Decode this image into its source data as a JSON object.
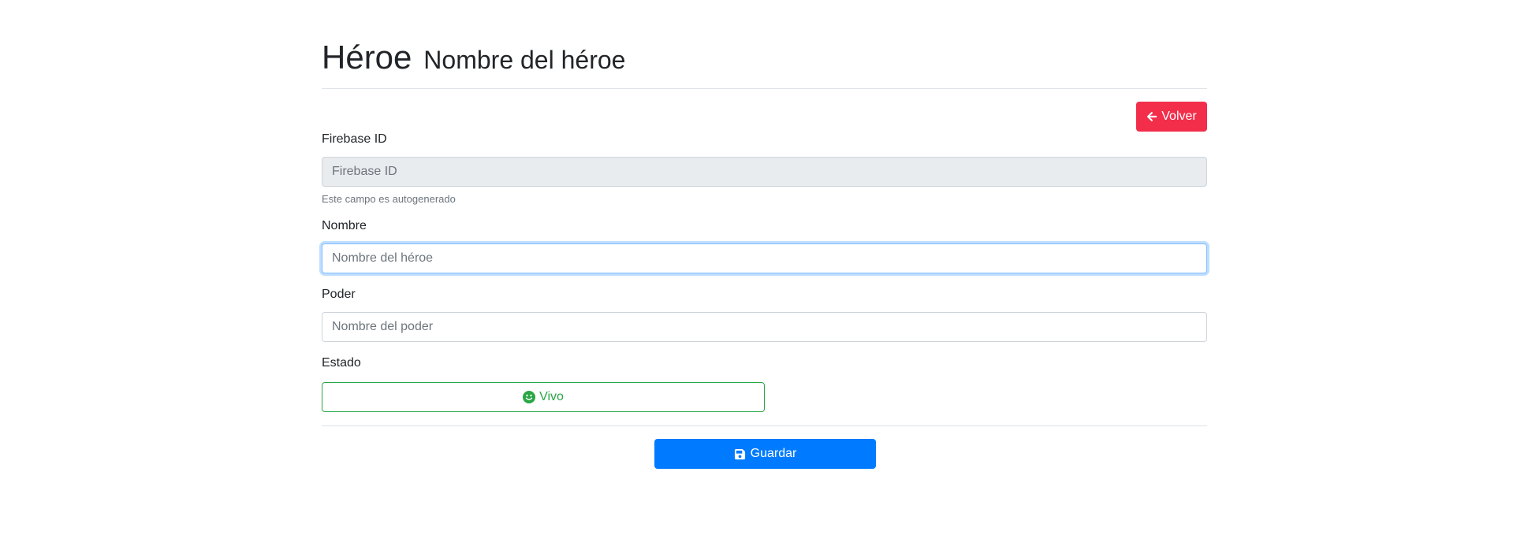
{
  "header": {
    "title": "Héroe",
    "subtitle": "Nombre del héroe"
  },
  "actions": {
    "back_label": "Volver",
    "back_icon": "arrow-left-icon",
    "back_color": "#f22e4b"
  },
  "form": {
    "firebase_id": {
      "label": "Firebase ID",
      "placeholder": "Firebase ID",
      "value": "",
      "help": "Este campo es autogenerado"
    },
    "nombre": {
      "label": "Nombre",
      "placeholder": "Nombre del héroe",
      "value": ""
    },
    "poder": {
      "label": "Poder",
      "placeholder": "Nombre del poder",
      "value": ""
    },
    "estado": {
      "label": "Estado",
      "button_label": "Vivo",
      "icon": "smile-icon",
      "color": "#28a745"
    },
    "save_label": "Guardar",
    "save_icon": "save-icon",
    "save_color": "#007bff"
  }
}
